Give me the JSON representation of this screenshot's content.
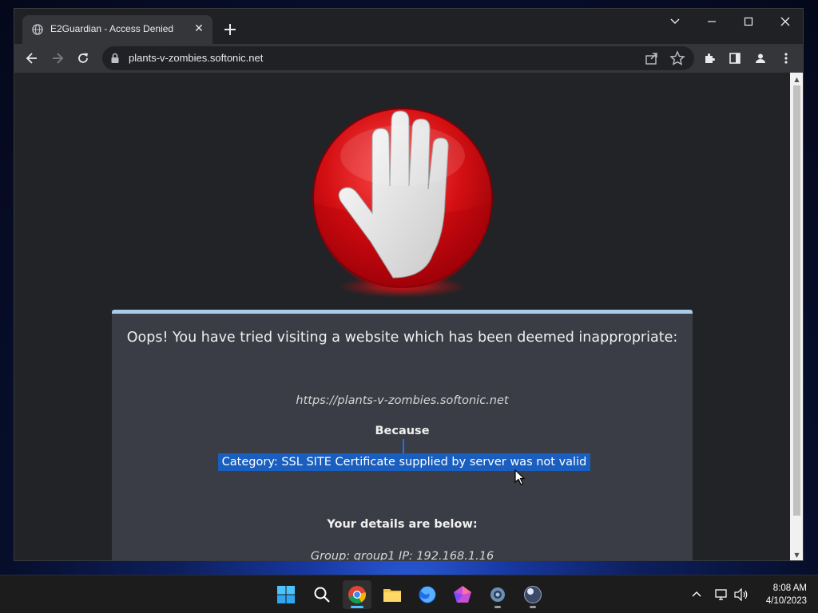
{
  "browser": {
    "tab_title": "E2Guardian - Access Denied",
    "tab_close": "✕",
    "new_tab": "+",
    "url": "plants-v-zombies.softonic.net"
  },
  "page": {
    "headline": "Oops! You have tried visiting a website which has been deemed inappropriate:",
    "blocked_url": "https://plants-v-zombies.softonic.net",
    "because_label": "Because",
    "reason": "Category: SSL SITE   Certificate supplied by server was not valid",
    "details_heading": "Your details are below:",
    "details": "Group: group1   IP: 192.168.1.16"
  },
  "taskbar": {
    "apps": [
      "start-icon",
      "search-icon",
      "chrome-icon",
      "file-explorer-icon",
      "firefox-icon",
      "app-icon",
      "settings-icon",
      "marble-app-icon"
    ],
    "time": "8:08 AM",
    "date": "4/10/2023"
  },
  "colors": {
    "selection": "#1a5fbf",
    "panel": "#3b3d46",
    "panel_border": "#a9cbe9"
  }
}
